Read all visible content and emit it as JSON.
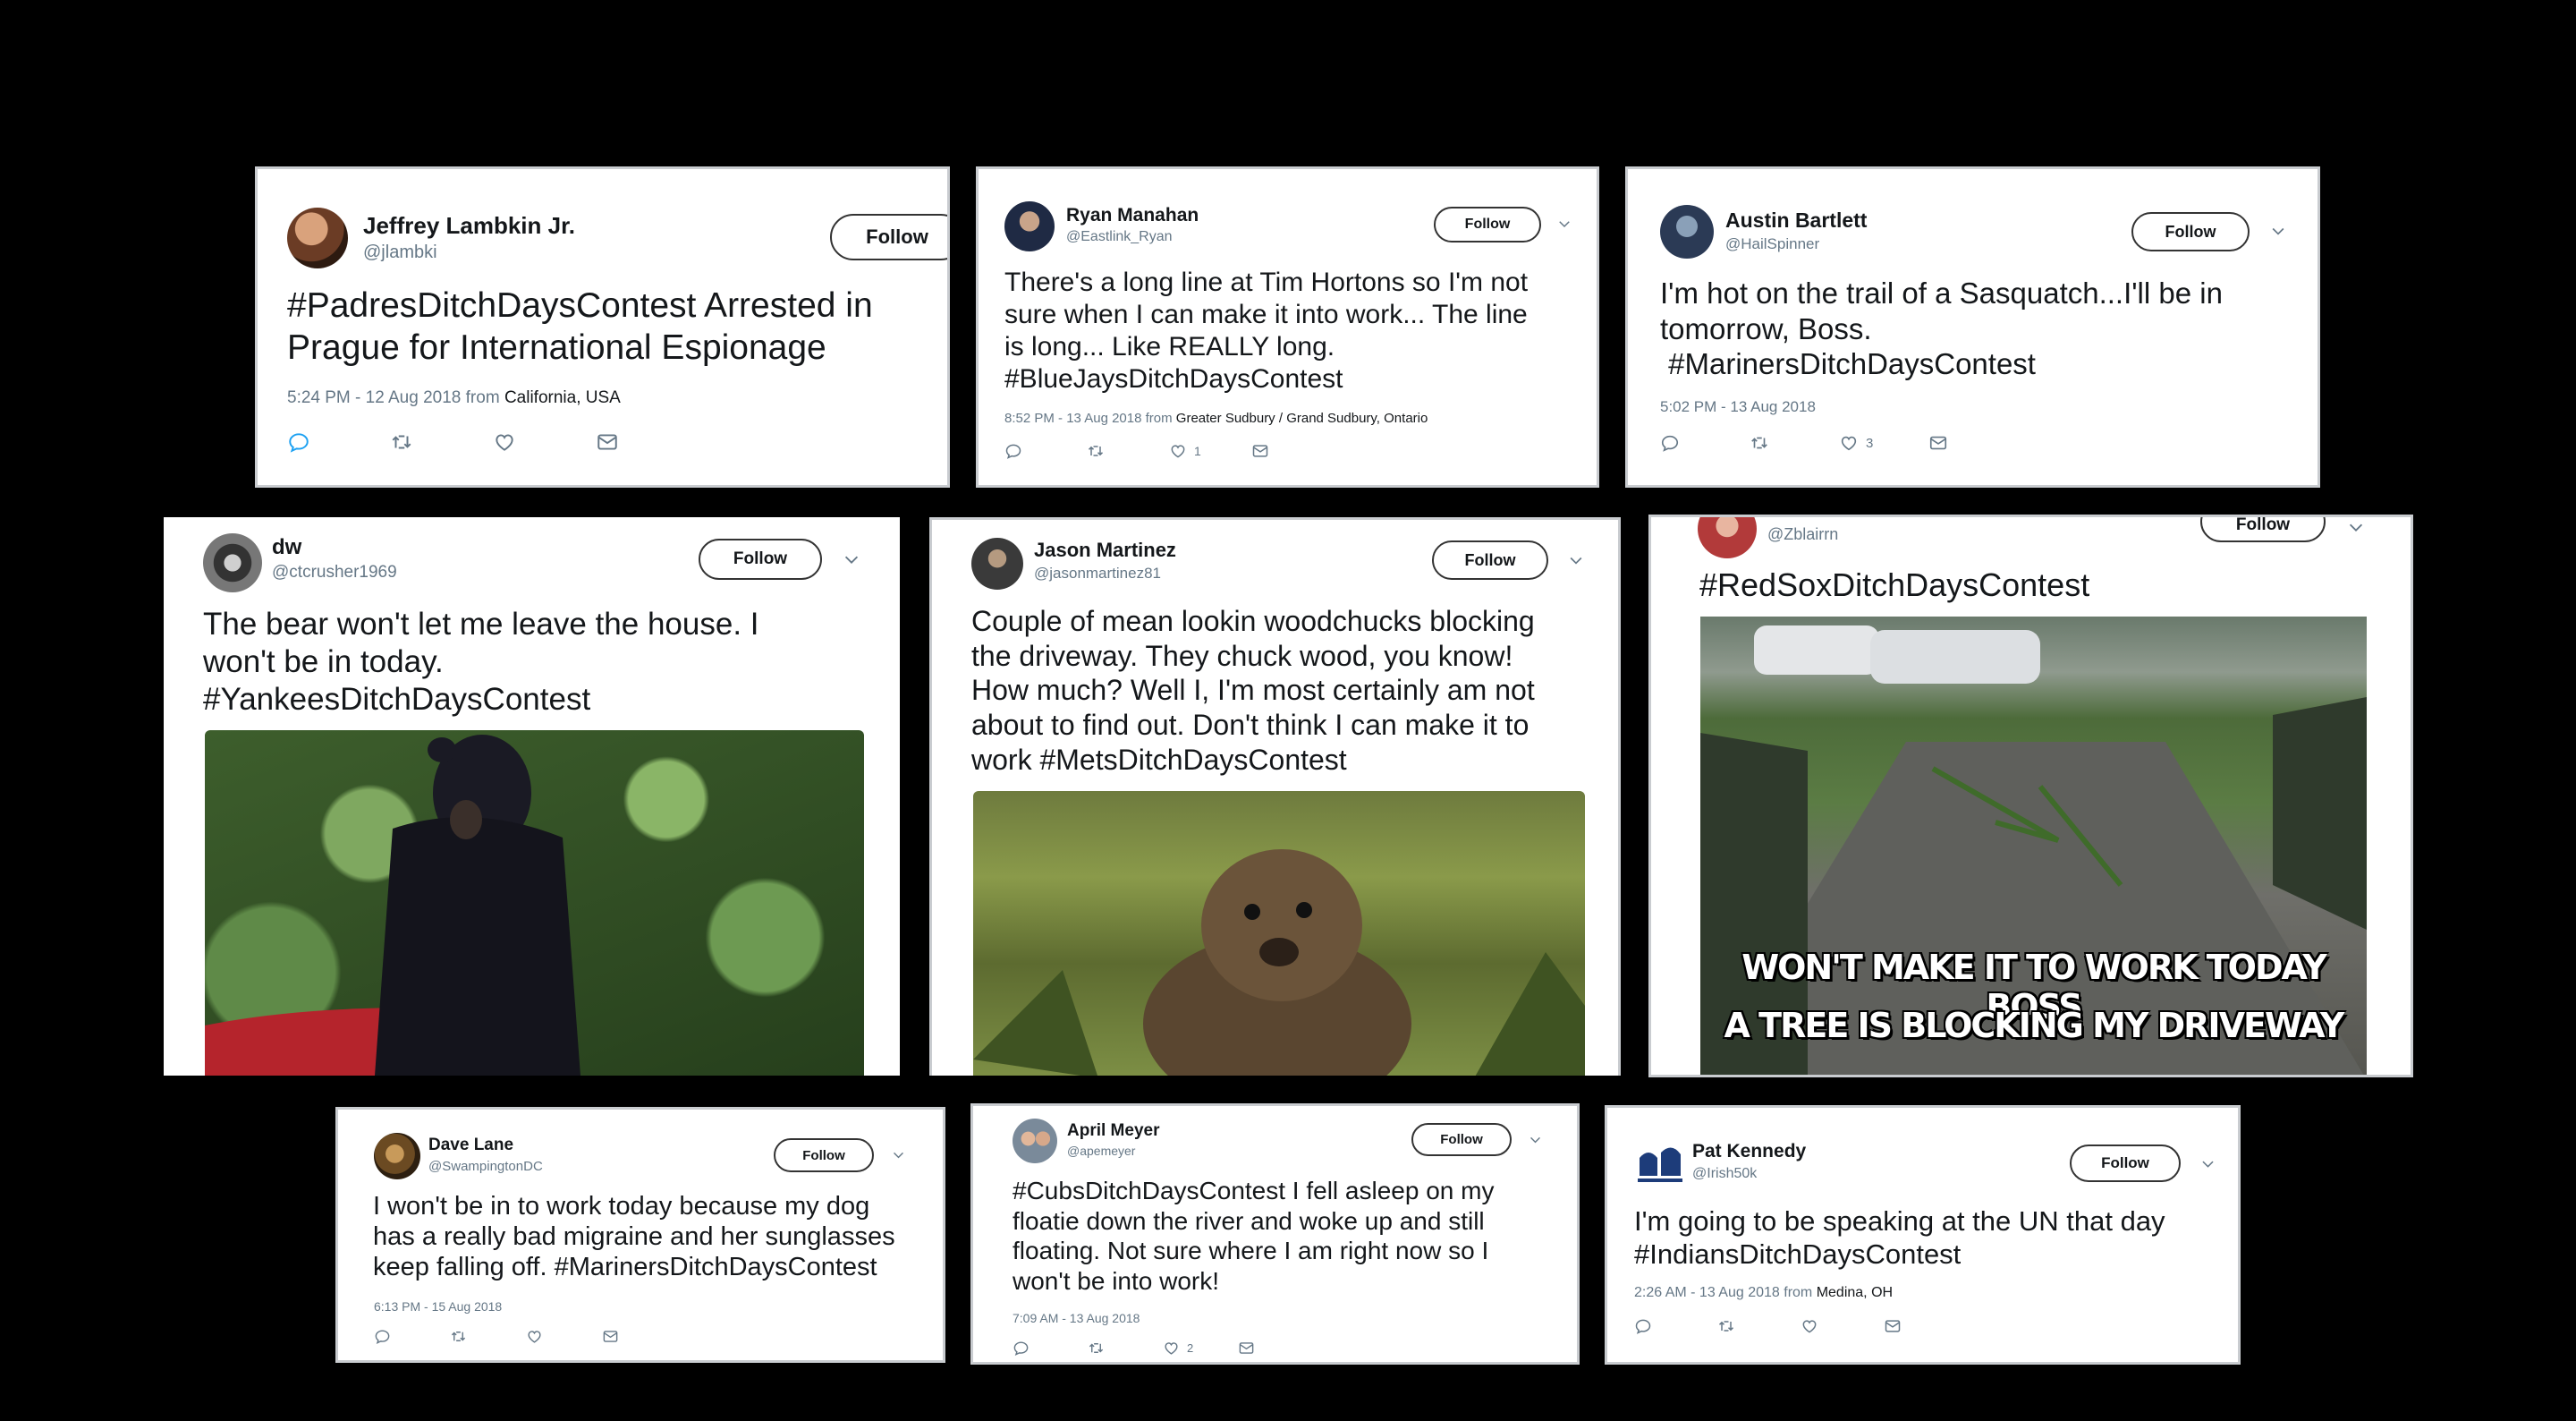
{
  "tweets": {
    "t1": {
      "name": "Jeffrey Lambkin Jr.",
      "handle": "@jlambki",
      "follow": "Follow",
      "lines": [
        "#PadresDitchDaysContest Arrested in",
        "Prague for International Espionage"
      ],
      "time": "5:24 PM - 12 Aug 2018",
      "from": "from",
      "location": "California, USA"
    },
    "t2": {
      "name": "Ryan Manahan",
      "handle": "@Eastlink_Ryan",
      "follow": "Follow",
      "lines": [
        "There's a long line at Tim Hortons so I'm not",
        "sure when I can make it into work...  The line",
        "is long... Like REALLY long.",
        "#BlueJaysDitchDaysContest"
      ],
      "time": "8:52 PM - 13 Aug 2018",
      "from": "from",
      "location": "Greater Sudbury / Grand Sudbury, Ontario",
      "likes": "1"
    },
    "t3": {
      "name": "Austin Bartlett",
      "handle": "@HailSpinner",
      "follow": "Follow",
      "lines": [
        "I'm hot on the trail of a Sasquatch...I'll be in",
        "tomorrow, Boss.",
        " #MarinersDitchDaysContest"
      ],
      "time": "5:02 PM - 13 Aug 2018",
      "likes": "3"
    },
    "t4": {
      "name": "dw",
      "handle": "@ctcrusher1969",
      "follow": "Follow",
      "lines": [
        "The bear won't let me leave the house. I",
        "won't be in today.",
        "#YankeesDitchDaysContest"
      ]
    },
    "t5": {
      "name": "Jason Martinez",
      "handle": "@jasonmartinez81",
      "follow": "Follow",
      "lines": [
        "Couple of mean lookin woodchucks blocking",
        "the driveway. They chuck wood, you know!",
        "How much? Well I, I'm most certainly am not",
        "about to find out. Don't think I can make it to",
        "work #MetsDitchDaysContest"
      ]
    },
    "t6": {
      "handle": "@Zblairrn",
      "follow": "Follow",
      "lines": [
        "#RedSoxDitchDaysContest"
      ],
      "meme_top": "WON'T MAKE IT TO WORK TODAY BOSS",
      "meme_bottom": "A TREE IS BLOCKING MY DRIVEWAY"
    },
    "t7": {
      "name": "Dave Lane",
      "handle": "@SwampingtonDC",
      "follow": "Follow",
      "lines": [
        "I won't be in to work today because my dog",
        "has a really bad migraine and her sunglasses",
        "keep falling off. #MarinersDitchDaysContest"
      ],
      "time": "6:13 PM - 15 Aug 2018"
    },
    "t8": {
      "name": "April Meyer",
      "handle": "@apemeyer",
      "follow": "Follow",
      "lines": [
        "#CubsDitchDaysContest I fell asleep on my",
        "floatie down the river and woke up and still",
        "floating. Not sure where I am right now so I",
        "won't be into work!"
      ],
      "time": "7:09 AM - 13 Aug 2018",
      "likes": "2"
    },
    "t9": {
      "name": "Pat Kennedy",
      "handle": "@Irish50k",
      "follow": "Follow",
      "lines": [
        "I'm going to be speaking at the UN that day",
        "#IndiansDitchDaysContest"
      ],
      "time": "2:26 AM - 13 Aug 2018",
      "from": "from",
      "location": "Medina, OH"
    }
  },
  "icons": [
    "reply-icon",
    "retweet-icon",
    "like-icon",
    "message-icon",
    "chevron-down-icon"
  ],
  "colors": {
    "background": "#000000",
    "card": "#ffffff",
    "text": "#14171a",
    "meta": "#657786",
    "accent": "#1da1f2"
  }
}
